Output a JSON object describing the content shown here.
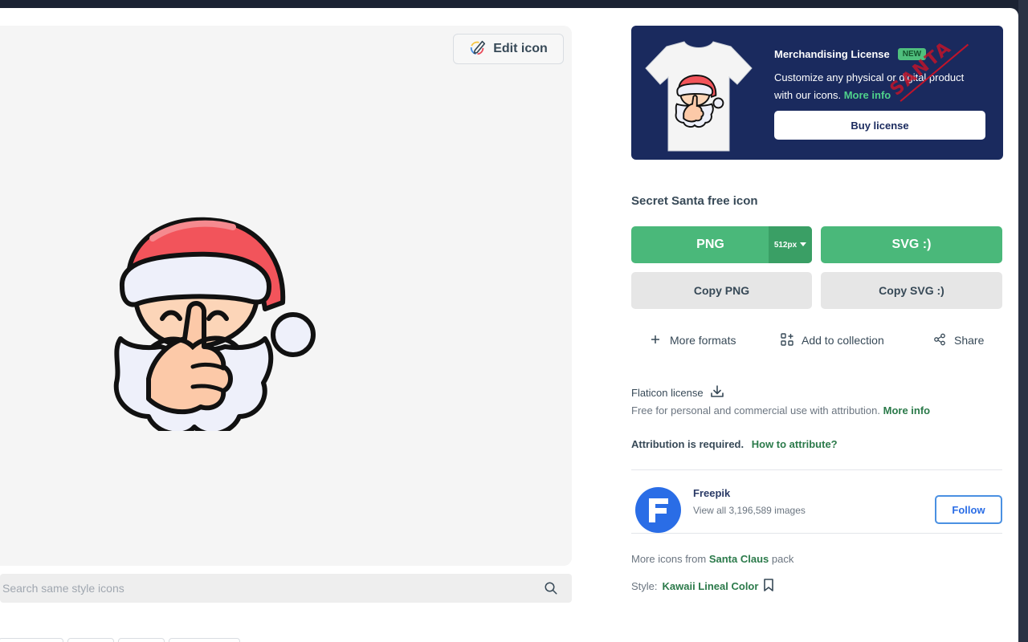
{
  "preview": {
    "edit_label": "Edit icon",
    "search_placeholder": "Search same style icons"
  },
  "merch": {
    "title": "Merchandising License",
    "badge": "NEW",
    "description": "Customize any physical or digital product with our icons.",
    "more_info": "More info",
    "buy_label": "Buy license",
    "stamp_text": "SANTA"
  },
  "icon": {
    "title": "Secret Santa free icon"
  },
  "download": {
    "png_label": "PNG",
    "png_size": "512px",
    "svg_label": "SVG :)",
    "copy_png_label": "Copy PNG",
    "copy_svg_label": "Copy SVG :)"
  },
  "actions": {
    "more_formats": "More formats",
    "add_collection": "Add to collection",
    "share": "Share"
  },
  "license": {
    "title": "Flaticon license",
    "description": "Free for personal and commercial use with attribution.",
    "more_info": "More info",
    "attribution": "Attribution is required.",
    "how_to": "How to attribute?"
  },
  "author": {
    "name": "Freepik",
    "subtitle": "View all 3,196,589 images",
    "follow_label": "Follow"
  },
  "pack": {
    "prefix": "More icons from",
    "name": "Santa Claus",
    "suffix": "pack"
  },
  "style": {
    "prefix": "Style:",
    "name": "Kawaii Lineal Color"
  },
  "colors": {
    "accent_green": "#4ab87a",
    "merch_bg": "#1a2a5e",
    "link_green": "#2b7a4a",
    "follow_blue": "#2a6de6"
  }
}
